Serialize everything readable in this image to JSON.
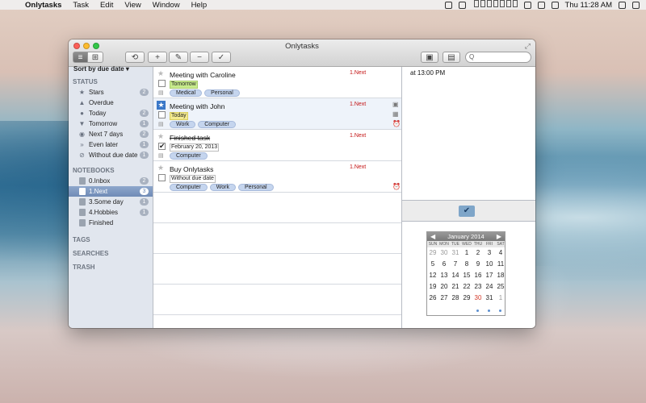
{
  "menubar": {
    "app": "Onlytasks",
    "menus": [
      "Task",
      "Edit",
      "View",
      "Window",
      "Help"
    ],
    "clock": "Thu 11:28 AM"
  },
  "window": {
    "title": "Onlytasks",
    "search_placeholder": "Q"
  },
  "toolbar": {
    "list_view": "≡",
    "grid_view": "⊞",
    "sync": "⟲",
    "add": "+",
    "edit": "✎",
    "remove": "−",
    "complete": "✓"
  },
  "sidebar": {
    "sort_label": "Sort by due date ▾",
    "status_header": "STATUS",
    "status_items": [
      {
        "label": "Stars",
        "count": "2",
        "icon": "★"
      },
      {
        "label": "Overdue",
        "count": "",
        "icon": "▲"
      },
      {
        "label": "Today",
        "count": "2",
        "icon": "●"
      },
      {
        "label": "Tomorrow",
        "count": "1",
        "icon": "▼"
      },
      {
        "label": "Next 7 days",
        "count": "2",
        "icon": "◉"
      },
      {
        "label": "Even later",
        "count": "1",
        "icon": "»"
      },
      {
        "label": "Without due date",
        "count": "1",
        "icon": "⊘"
      }
    ],
    "notebooks_header": "NOTEBOOKS",
    "notebooks": [
      {
        "label": "0.Inbox",
        "count": "2"
      },
      {
        "label": "1.Next",
        "count": "3"
      },
      {
        "label": "3.Some day",
        "count": "1"
      },
      {
        "label": "4.Hobbies",
        "count": "1"
      },
      {
        "label": "Finished",
        "count": ""
      }
    ],
    "tags_header": "TAGS",
    "searches_header": "SEARCHES",
    "trash_header": "TRASH"
  },
  "tasks": [
    {
      "title": "Meeting with Caroline",
      "priority": "1.Next",
      "due": "Tomorrow",
      "tags": [
        "Medical",
        "Personal"
      ]
    },
    {
      "title": "Meeting with John",
      "priority": "1.Next",
      "due": "Today",
      "tags": [
        "Work",
        "Computer"
      ]
    },
    {
      "title": "Finished task",
      "priority": "1.Next",
      "due": "February 20, 2013",
      "tags": [
        "Computer"
      ]
    },
    {
      "title": "Buy Onlytasks",
      "priority": "1.Next",
      "due": "Without due date",
      "tags": [
        "Computer",
        "Work",
        "Personal"
      ]
    }
  ],
  "detail": {
    "time": "at 13:00 PM"
  },
  "calendar": {
    "month": "January 2014",
    "dows": [
      "SUN",
      "MON",
      "TUE",
      "WED",
      "THU",
      "FRI",
      "SAT"
    ],
    "days": [
      "29",
      "30",
      "31",
      "1",
      "2",
      "3",
      "4",
      "5",
      "6",
      "7",
      "8",
      "9",
      "10",
      "11",
      "12",
      "13",
      "14",
      "15",
      "16",
      "17",
      "18",
      "19",
      "20",
      "21",
      "22",
      "23",
      "24",
      "25",
      "26",
      "27",
      "28",
      "29",
      "30",
      "31",
      "1"
    ]
  }
}
